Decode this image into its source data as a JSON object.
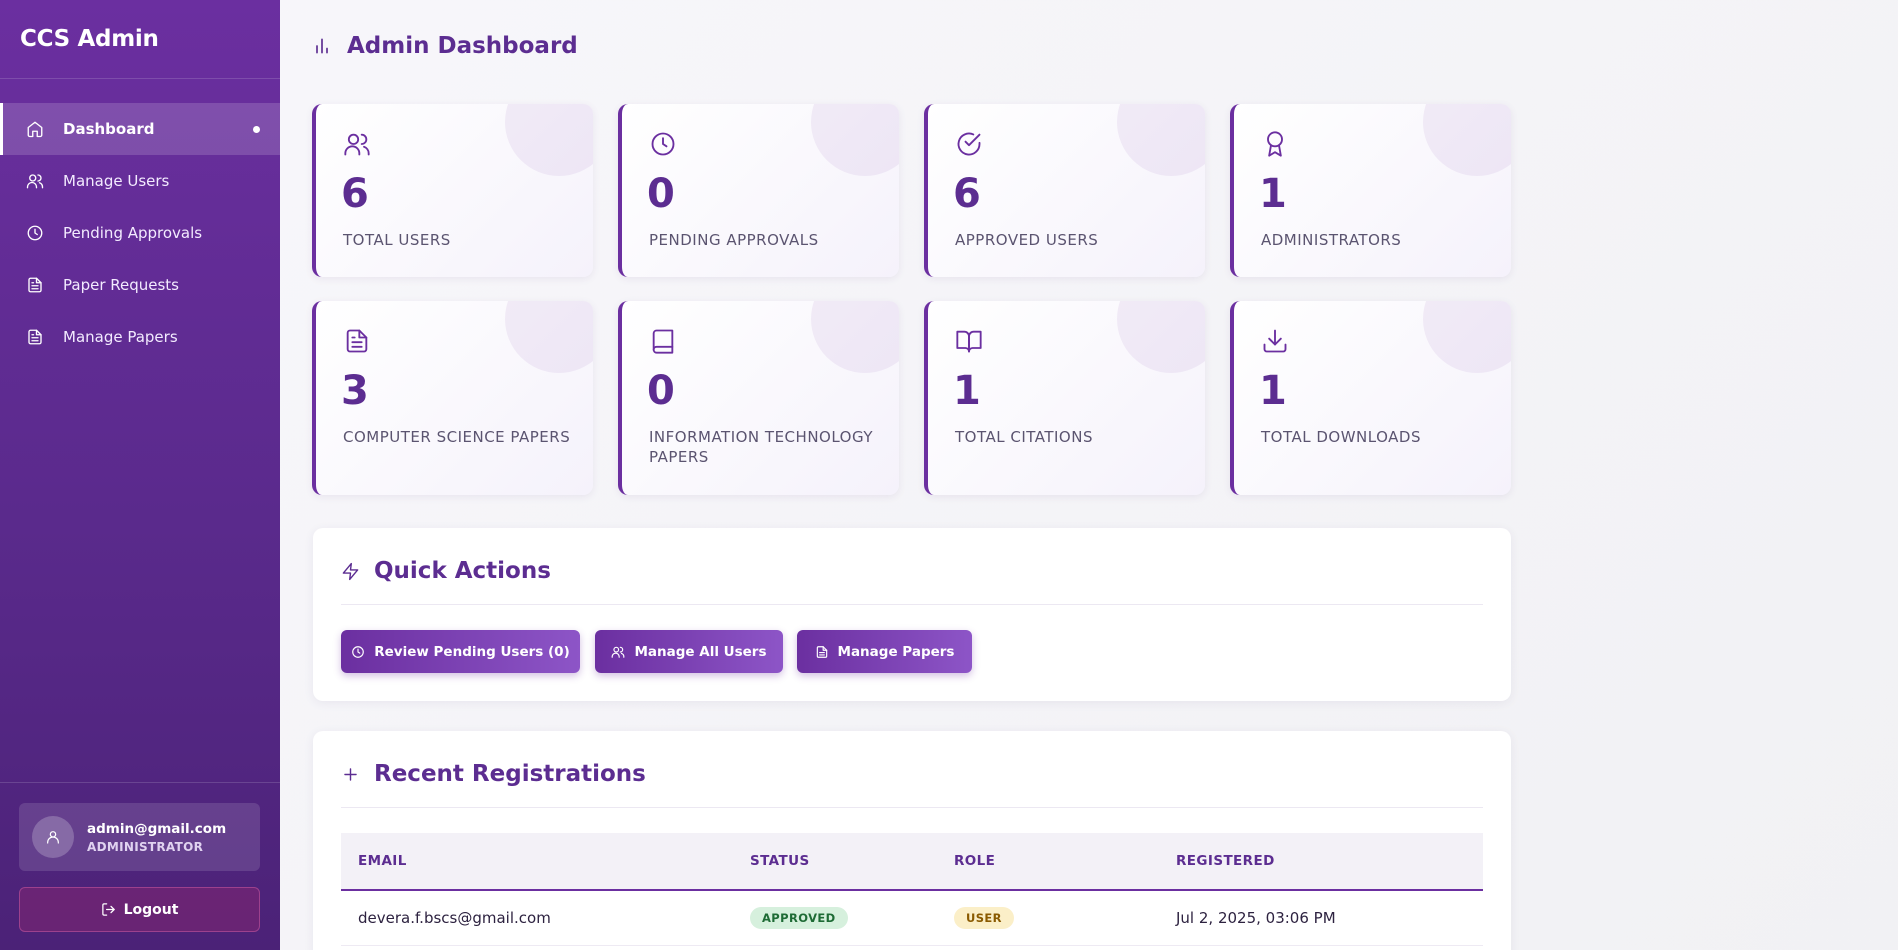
{
  "sidebar": {
    "brand": "CCS Admin",
    "items": [
      {
        "label": "Dashboard",
        "icon": "home-icon",
        "active": true
      },
      {
        "label": "Manage Users",
        "icon": "users-icon"
      },
      {
        "label": "Pending Approvals",
        "icon": "clock-icon"
      },
      {
        "label": "Paper Requests",
        "icon": "document-icon"
      },
      {
        "label": "Manage Papers",
        "icon": "document-icon"
      }
    ],
    "user": {
      "email": "admin@gmail.com",
      "role": "ADMINISTRATOR"
    },
    "logout_label": "Logout"
  },
  "header": {
    "title": "Admin Dashboard",
    "icon": "bar-chart-icon"
  },
  "stats": [
    {
      "value": "6",
      "label": "TOTAL USERS",
      "icon": "users-icon"
    },
    {
      "value": "0",
      "label": "PENDING APPROVALS",
      "icon": "clock-icon"
    },
    {
      "value": "6",
      "label": "APPROVED USERS",
      "icon": "check-circle-icon"
    },
    {
      "value": "1",
      "label": "ADMINISTRATORS",
      "icon": "award-icon"
    },
    {
      "value": "3",
      "label": "COMPUTER SCIENCE PAPERS",
      "icon": "document-icon"
    },
    {
      "value": "0",
      "label": "INFORMATION TECHNOLOGY PAPERS",
      "icon": "book-icon"
    },
    {
      "value": "1",
      "label": "TOTAL CITATIONS",
      "icon": "open-book-icon"
    },
    {
      "value": "1",
      "label": "TOTAL DOWNLOADS",
      "icon": "download-icon"
    }
  ],
  "quick_actions": {
    "title": "Quick Actions",
    "icon": "lightning-icon",
    "buttons": [
      {
        "label": "Review Pending Users (0)",
        "icon": "clock-icon"
      },
      {
        "label": "Manage All Users",
        "icon": "users-icon"
      },
      {
        "label": "Manage Papers",
        "icon": "document-icon"
      }
    ]
  },
  "recent": {
    "title": "Recent Registrations",
    "icon": "plus-icon",
    "columns": [
      "EMAIL",
      "STATUS",
      "ROLE",
      "REGISTERED"
    ],
    "rows": [
      {
        "email": "devera.f.bscs@gmail.com",
        "status": "APPROVED",
        "role": "USER",
        "registered": "Jul 2, 2025, 03:06 PM"
      }
    ]
  },
  "colors": {
    "primary": "#6b2fa0",
    "title": "#5c2d91",
    "approved_bg": "#d6f0dd",
    "user_bg": "#fbefc8"
  }
}
